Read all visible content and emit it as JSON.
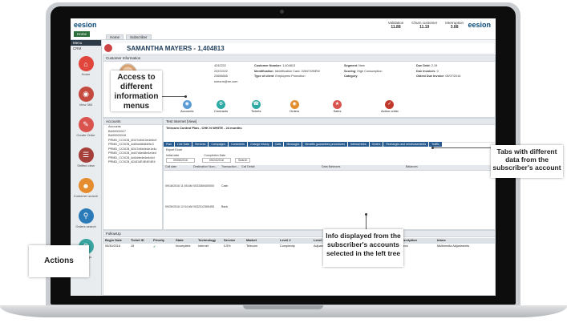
{
  "app": {
    "logo": "eesion",
    "home_tab": "Home",
    "crumbs": [
      "Home",
      "Subscriber"
    ]
  },
  "header_stats": [
    {
      "label": "Validation",
      "value": "11.88"
    },
    {
      "label": "Churn customer",
      "value": "11.19"
    },
    {
      "label": "Interruption",
      "value": "3.88"
    }
  ],
  "menu": {
    "title": "Menu",
    "section": "CRM",
    "items": [
      {
        "label": "Home",
        "icon": "home-icon",
        "color": "#e0463c"
      },
      {
        "label": "View 360",
        "icon": "view-360-icon",
        "color": "#c44a3f"
      },
      {
        "label": "Create Order",
        "icon": "create-order-icon",
        "color": "#d9534f"
      },
      {
        "label": "Shifted view",
        "icon": "shifted-view-icon",
        "color": "#a53f39"
      },
      {
        "label": "Customer search",
        "icon": "customer-search-icon",
        "color": "#e58c2e"
      },
      {
        "label": "Orders search",
        "icon": "orders-search-icon",
        "color": "#2b7bb9"
      },
      {
        "label": "Settings",
        "icon": "settings-icon",
        "color": "#3aa4a0"
      }
    ]
  },
  "customer": {
    "name": "SAMANTHA MAYERS",
    "id": "1,404813",
    "section_title": "Customer Information",
    "left_fields": [
      "4242222",
      "22222222",
      "23656565",
      "smrorm@rm.com"
    ],
    "mid_fields": [
      {
        "k": "Customer Number",
        "v": "1,404813"
      },
      {
        "k": "Identification",
        "v": "Identification Card: 2284722BEW"
      },
      {
        "k": "Type of client",
        "v": "Employees Promotion"
      }
    ],
    "right_fields": [
      {
        "k": "Segment",
        "v": "New"
      },
      {
        "k": "Scoring",
        "v": "High Consumption"
      },
      {
        "k": "Category",
        "v": ""
      }
    ],
    "far_fields": [
      {
        "k": "Due Debt",
        "v": "2.19"
      },
      {
        "k": "Due Invoices",
        "v": "0"
      },
      {
        "k": "Oldest Due Invoice",
        "v": "05/07/2016"
      }
    ],
    "clusters": [
      {
        "label": "Accounts",
        "color": "#5b9bd5"
      },
      {
        "label": "Contracts",
        "color": "#2eaaa4"
      },
      {
        "label": "Tickets",
        "color": "#2eaaa4"
      },
      {
        "label": "Orders",
        "color": "#e38c2c"
      },
      {
        "label": "Sales",
        "color": "#d9534f"
      },
      {
        "label": "Action onlist",
        "color": "#c0392b"
      }
    ]
  },
  "accounts_tree": {
    "title": "Accounts",
    "items": [
      "Accounts",
      "BA00000017",
      "BA00000018",
      "PRMD_CC0CB_4D47d4b10e4e6c9",
      "PRMD_CC0CB_4d84d48484f6c3",
      "PRMD_CC0CB_4D47d4b4e4e1e4c",
      "PRMD_CC0CB_4d47d4e48e4e4e4",
      "PRMD_CC0CB_4d4d4e4e4e4c4d",
      "PRMD_CC0CB_4D4D4E4E4E4E4"
    ]
  },
  "detail": {
    "title": "Test Internet [View]",
    "plan": "Telecom Control Plan - CHK N WHITE - 24 months",
    "tabs": [
      "Plan",
      "Line Data",
      "Services",
      "Campaigns",
      "Comments",
      "Change history",
      "Calls",
      "Messages",
      "Benefits guarantees procedures",
      "Internal links",
      "Orders",
      "Recharges and reimbursements",
      "Traffic"
    ],
    "export": "Export Excel",
    "initial_date_label": "Initial date",
    "initial_date": "09/08/2016",
    "completion_label": "Completion Date",
    "completion_date": "05/24/2016",
    "search": "Search",
    "columns": [
      "Call date",
      "Destination Num...",
      "Transaction...",
      "Call Detail",
      "Data Balances",
      "Balances"
    ],
    "rows": [
      {
        "date": "09/18/2016 11:05 AM",
        "dest": "0033365400000",
        "type": "Cash"
      },
      {
        "date": "09/26/2016 12:04 AM",
        "dest": "0032312365455",
        "type": "Bank"
      }
    ]
  },
  "followup": {
    "title": "FollowUp",
    "columns": [
      "Begin Date",
      "Ticket ID",
      "Priority",
      "State",
      "Technology",
      "Service",
      "Market",
      "Level 2",
      "Level 3",
      "Description",
      "Inbox"
    ],
    "row": [
      "05/30/2016",
      "15",
      "✔",
      "Incomplete",
      "Internet",
      "0.5%",
      "Telecom",
      "Complexity",
      "Adjustments",
      "Check",
      "Multimedia Adjustments"
    ]
  },
  "callouts": {
    "menus": "Access to different information menus",
    "tabs": "Tabs with different data from the subscriber's account",
    "info": "Info displayed from the subscriber's accounts selected in the left tree",
    "actions": "Actions"
  }
}
